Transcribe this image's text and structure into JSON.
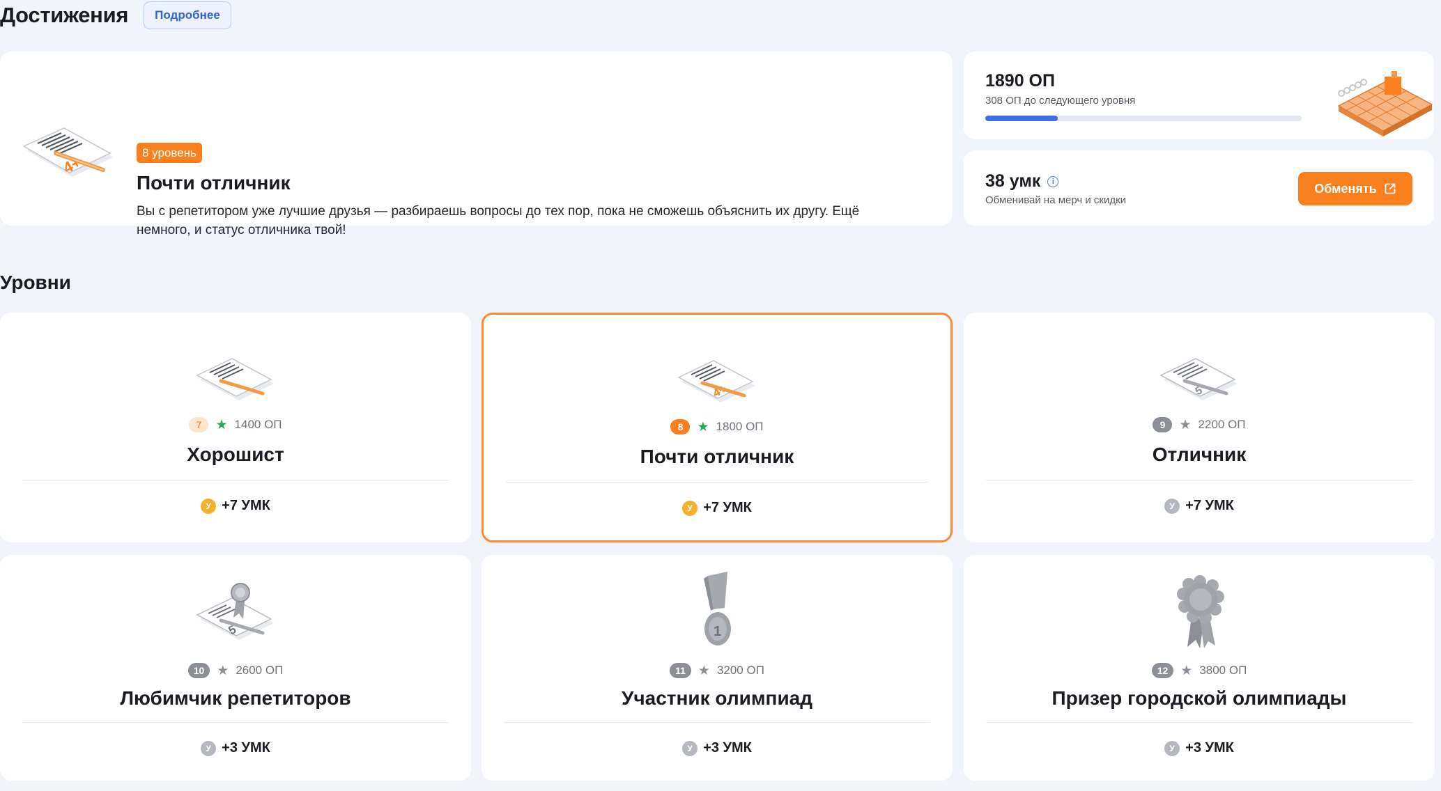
{
  "header": {
    "title": "Достижения",
    "more_label": "Подробнее"
  },
  "current_level": {
    "badge": "8 уровень",
    "title": "Почти отличник",
    "description": "Вы с репетитором уже лучшие друзья — разбираешь вопросы до тех пор, пока не сможешь объяснить их другу. Ещё немного, и статус отличника твой!",
    "icon": "graded-paper-4plus-icon"
  },
  "points": {
    "value": "1890 ОП",
    "subtitle": "308 ОП до следующего уровня",
    "progress": 0.23,
    "accent": "#3d6fe3",
    "icon": "isometric-board-icon"
  },
  "umk": {
    "value": "38 умк",
    "subtitle": "Обменивай на мерч и скидки",
    "exchange_label": "Обменять",
    "accent": "#fb7f1c"
  },
  "levels_section": {
    "title": "Уровни"
  },
  "levels": [
    {
      "num": "7",
      "points": "1400 ОП",
      "name": "Хорошист",
      "reward": "+7 УМК",
      "coin": "У",
      "state": "past",
      "icon": "graded-paper-icon"
    },
    {
      "num": "8",
      "points": "1800 ОП",
      "name": "Почти отличник",
      "reward": "+7 УМК",
      "coin": "У",
      "state": "current",
      "icon": "graded-paper-4plus-icon"
    },
    {
      "num": "9",
      "points": "2200 ОП",
      "name": "Отличник",
      "reward": "+7 УМК",
      "coin": "У",
      "state": "locked",
      "icon": "graded-paper-5-icon"
    },
    {
      "num": "10",
      "points": "2600 ОП",
      "name": "Любимчик репетиторов",
      "reward": "+3 УМК",
      "coin": "У",
      "state": "locked",
      "icon": "paper-ribbon-icon"
    },
    {
      "num": "11",
      "points": "3200 ОП",
      "name": "Участник олимпиад",
      "reward": "+3 УМК",
      "coin": "У",
      "state": "locked",
      "icon": "medal-icon"
    },
    {
      "num": "12",
      "points": "3800 ОП",
      "name": "Призер городской олимпиады",
      "reward": "+3 УМК",
      "coin": "У",
      "state": "locked",
      "icon": "rosette-icon"
    }
  ]
}
